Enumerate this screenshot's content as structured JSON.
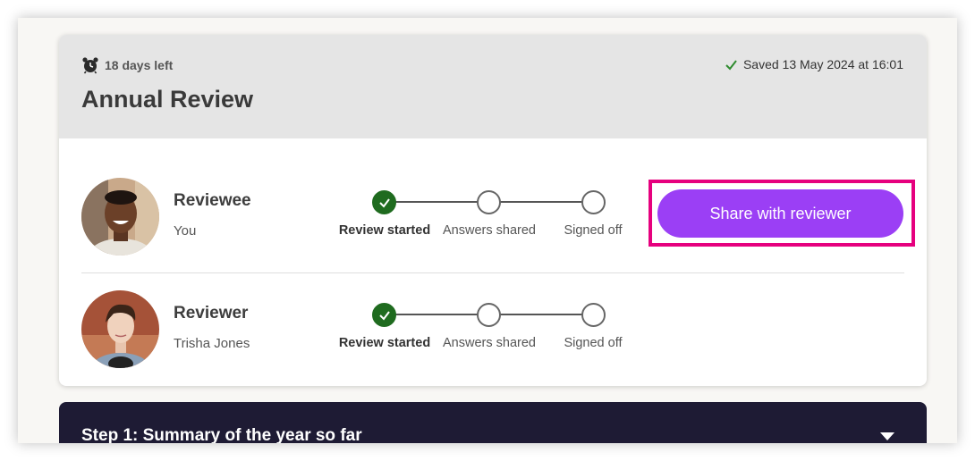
{
  "header": {
    "deadline_text": "18 days left",
    "title": "Annual Review",
    "saved_text": "Saved 13 May 2024 at 16:01"
  },
  "steps": [
    "Review started",
    "Answers shared",
    "Signed off"
  ],
  "participants": [
    {
      "role": "Reviewee",
      "name": "You",
      "completed_step": "Review started"
    },
    {
      "role": "Reviewer",
      "name": "Trisha Jones",
      "completed_step": "Review started"
    }
  ],
  "actions": {
    "share_label": "Share with reviewer"
  },
  "section": {
    "step_title": "Step 1: Summary of the year so far"
  },
  "colors": {
    "accent": "#9b3ff5",
    "highlight": "#e6007e",
    "done": "#1f6b1f",
    "dark_panel": "#1e1b34"
  },
  "icons": {
    "deadline": "alarm-clock-icon",
    "saved": "check-icon",
    "expand": "caret-down-icon"
  }
}
